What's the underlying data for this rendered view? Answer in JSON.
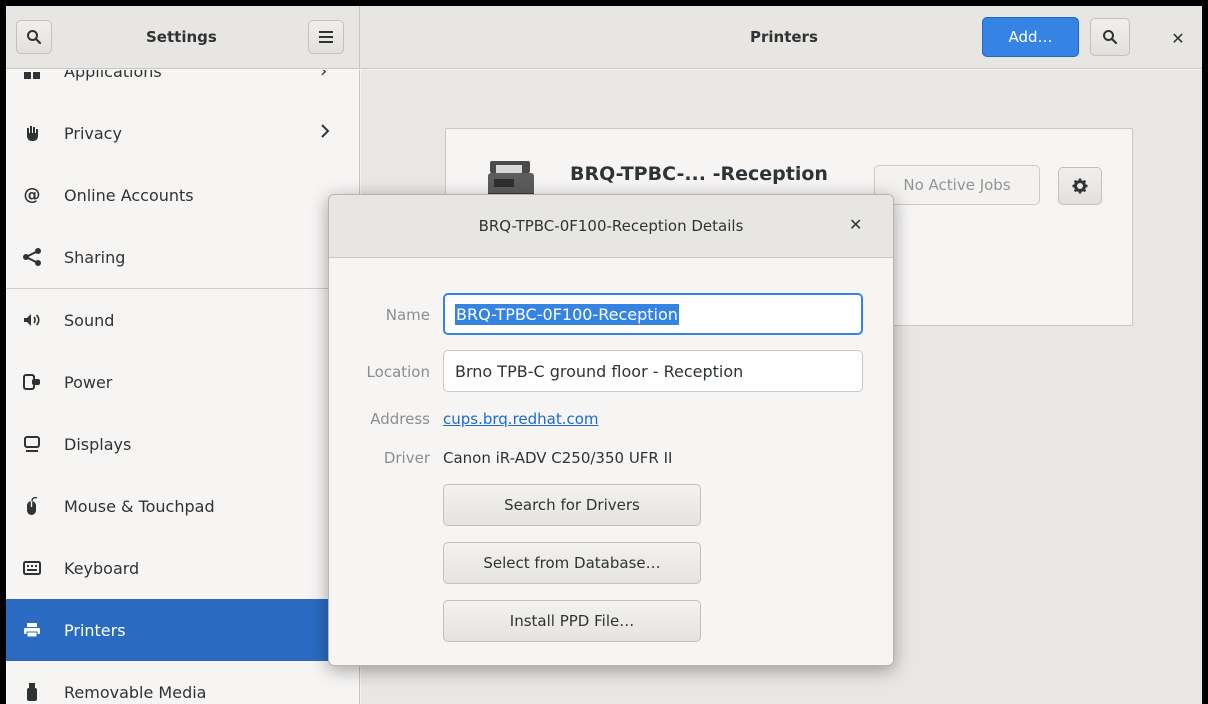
{
  "header": {
    "sidebar_title": "Settings",
    "main_title": "Printers",
    "add_label": "Add…"
  },
  "sidebar": {
    "items": [
      {
        "label": "Applications",
        "icon": "applications-icon",
        "chevron": true
      },
      {
        "label": "Privacy",
        "icon": "hand-icon",
        "chevron": true
      },
      {
        "label": "Online Accounts",
        "icon": "at-icon"
      },
      {
        "label": "Sharing",
        "icon": "share-icon"
      },
      {
        "label": "Sound",
        "icon": "speaker-icon"
      },
      {
        "label": "Power",
        "icon": "power-plug-icon"
      },
      {
        "label": "Displays",
        "icon": "display-icon"
      },
      {
        "label": "Mouse & Touchpad",
        "icon": "mouse-icon"
      },
      {
        "label": "Keyboard",
        "icon": "keyboard-icon"
      },
      {
        "label": "Printers",
        "icon": "printer-icon",
        "active": true
      },
      {
        "label": "Removable Media",
        "icon": "usb-drive-icon"
      }
    ]
  },
  "printer_card": {
    "name": "BRQ-TPBC-...  -Reception",
    "jobs_label": "No Active Jobs"
  },
  "dialog": {
    "title": "BRQ-TPBC-0F100-Reception Details",
    "name_label": "Name",
    "name_value": "BRQ-TPBC-0F100-Reception",
    "location_label": "Location",
    "location_value": "Brno TPB-C ground floor - Reception",
    "address_label": "Address",
    "address_value": "cups.brq.redhat.com",
    "driver_label": "Driver",
    "driver_value": "Canon iR-ADV C250/350 UFR II",
    "search_drivers_label": "Search for Drivers",
    "select_database_label": "Select from Database…",
    "install_ppd_label": "Install PPD File…"
  },
  "colors": {
    "accent": "#3584e4",
    "sidebar_active": "#2a6bc1"
  }
}
